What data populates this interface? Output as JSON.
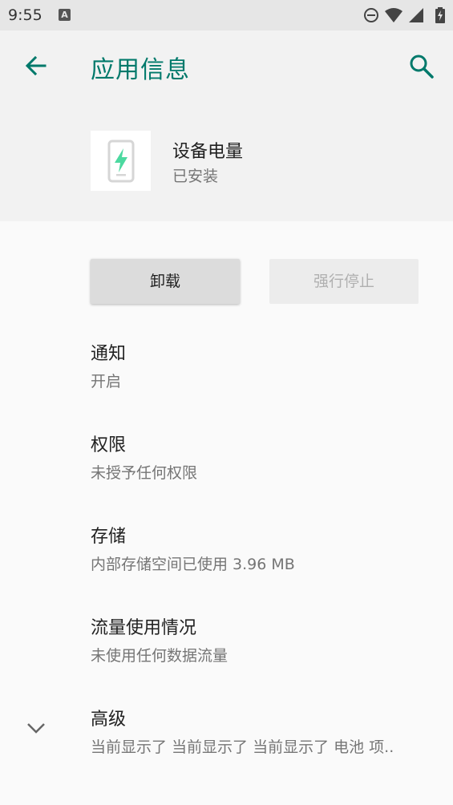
{
  "status_bar": {
    "time": "9:55",
    "notification_glyph": "A"
  },
  "toolbar": {
    "title": "应用信息"
  },
  "app": {
    "name": "设备电量",
    "install_status": "已安装",
    "accent_color": "#00796b",
    "icon_color": "#4cd9a0"
  },
  "actions": {
    "uninstall_label": "卸载",
    "force_stop_label": "强行停止"
  },
  "preferences": [
    {
      "title": "通知",
      "summary": "开启"
    },
    {
      "title": "权限",
      "summary": "未授予任何权限"
    },
    {
      "title": "存储",
      "summary": "内部存储空间已使用 3.96 MB"
    },
    {
      "title": "流量使用情况",
      "summary": "未使用任何数据流量"
    },
    {
      "title": "高级",
      "summary": "当前显示了 当前显示了 当前显示了 电池 项.."
    }
  ]
}
